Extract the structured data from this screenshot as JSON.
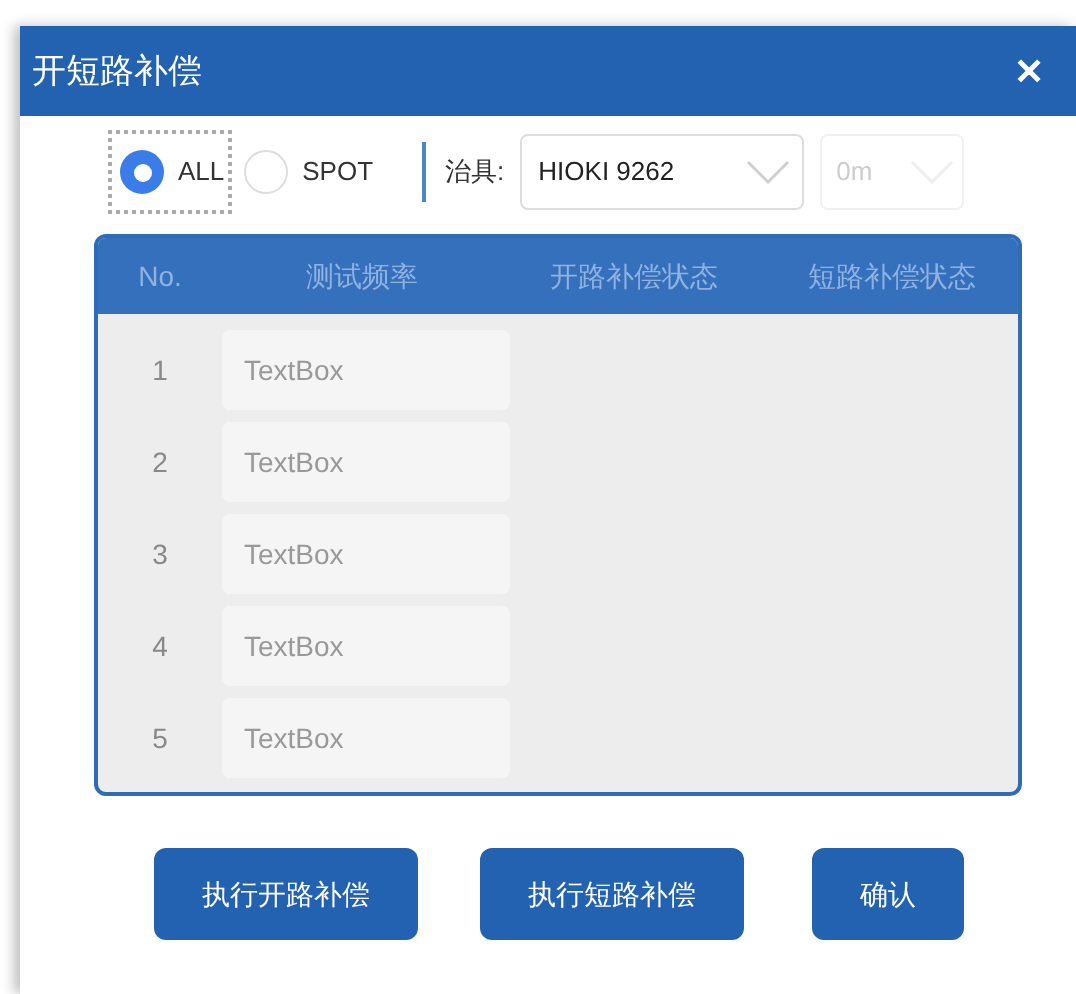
{
  "window": {
    "title": "开短路补偿",
    "close": "✕"
  },
  "mode": {
    "options": [
      {
        "label": "ALL",
        "selected": true,
        "focused": true
      },
      {
        "label": "SPOT",
        "selected": false,
        "focused": false
      }
    ]
  },
  "fixture": {
    "label": "治具:",
    "value": "HIOKI 9262",
    "disabled": false
  },
  "cable": {
    "value": "0m",
    "disabled": true
  },
  "table": {
    "disabled": true,
    "columns": [
      "No.",
      "测试频率",
      "开路补偿状态",
      "短路补偿状态"
    ],
    "rows": [
      {
        "no": "1",
        "frequency": "TextBox"
      },
      {
        "no": "2",
        "frequency": "TextBox"
      },
      {
        "no": "3",
        "frequency": "TextBox"
      },
      {
        "no": "4",
        "frequency": "TextBox"
      },
      {
        "no": "5",
        "frequency": "TextBox"
      }
    ]
  },
  "buttons": [
    "执行开路补偿",
    "执行短路补偿",
    "确认"
  ]
}
